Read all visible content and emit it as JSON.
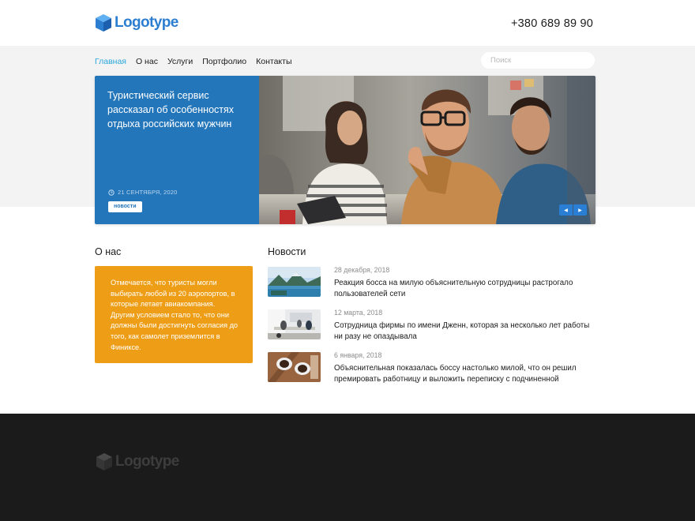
{
  "header": {
    "logo_text": "Logotype",
    "phone": "+380 689 89 90"
  },
  "nav": {
    "items": [
      "Главная",
      "О нас",
      "Услуги",
      "Портфолио",
      "Контакты"
    ],
    "active_index": 0
  },
  "search": {
    "placeholder": "Поиск",
    "value": ""
  },
  "slider": {
    "title": "Туристический сервис рассказал об особенностях отдыха российских мужчин",
    "date": "21 СЕНТЯБРЯ, 2020",
    "tag": "новости",
    "prev_icon": "triangle-left",
    "next_icon": "triangle-right"
  },
  "about": {
    "title": "О нас",
    "text": "Отмечается, что туристы могли выбирать любой из 20 аэропортов, в которые летает авиакомпания. Другим условием стало то, что они должны были достигнуть согласия до того, как самолет приземлится в Финиксе."
  },
  "news": {
    "title": "Новости",
    "items": [
      {
        "date": "28 декабря, 2018",
        "headline": "Реакция босса на милую объяснительную сотрудницы растрогало пользователей сети",
        "thumb": "mountain-lake"
      },
      {
        "date": "12 марта, 2018",
        "headline": "Сотрудница фирмы по имени Дженн, которая за несколько лет работы ни разу не опаздывала",
        "thumb": "office-interior"
      },
      {
        "date": "6 января, 2018",
        "headline": "Объяснительная показалась боссу настолько милой, что он решил премировать работницу и выложить переписку с подчиненной",
        "thumb": "coffee-cups"
      }
    ]
  },
  "footer": {
    "logo_text": "Logotype"
  },
  "colors": {
    "brand_blue": "#2c7ed1",
    "nav_active": "#2aa6dc",
    "slide_blue": "#2476bb",
    "about_orange": "#ee9e16",
    "footer_bg": "#1b1b1b",
    "band_bg": "#f3f3f3"
  }
}
